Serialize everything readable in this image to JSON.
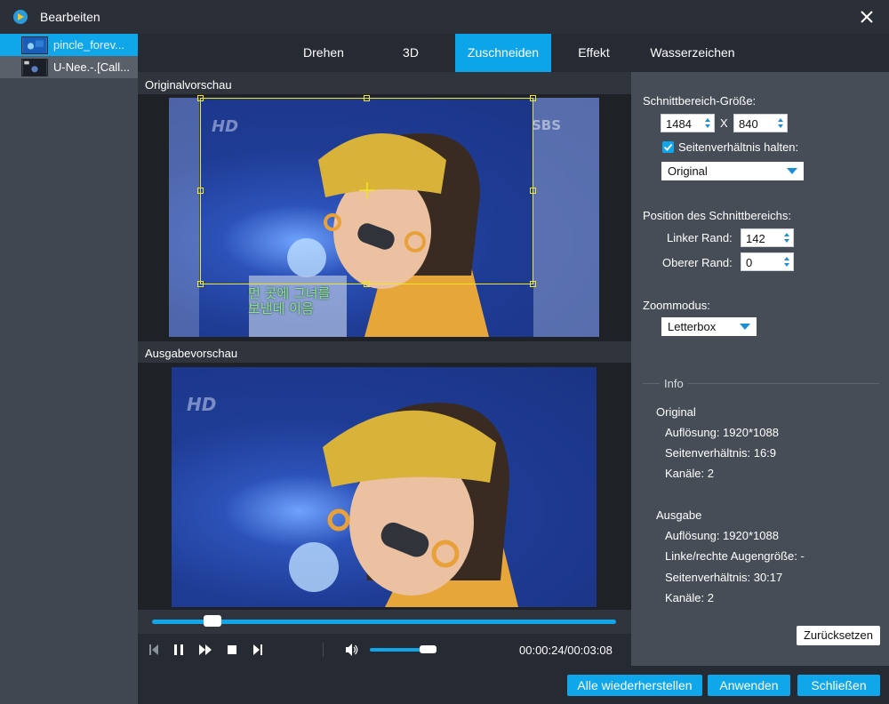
{
  "window": {
    "title": "Bearbeiten"
  },
  "files": [
    {
      "name": "pincle_forev...",
      "active": true
    },
    {
      "name": "U-Nee.-.[Call...",
      "active": false
    }
  ],
  "tabs": [
    "Drehen",
    "3D",
    "Zuschneiden",
    "Effekt",
    "Wasserzeichen"
  ],
  "active_tab": "Zuschneiden",
  "preview": {
    "original_label": "Originalvorschau",
    "output_label": "Ausgabevorschau",
    "hd_mark": "HD",
    "sbs_mark": "SBS",
    "subtitle_line1": "먼 곳에 그녀를",
    "subtitle_line2": "보낸데 이음"
  },
  "playback": {
    "time": "00:00:24/00:03:08",
    "progress": 0.13,
    "volume": 0.75
  },
  "crop": {
    "size_label": "Schnittbereich-Größe:",
    "width": "1484",
    "x_sep": "X",
    "height": "840",
    "keep_ratio_label": "Seitenverhältnis halten:",
    "keep_ratio_checked": true,
    "ratio_value": "Original",
    "position_label": "Position des Schnittbereichs:",
    "left_label": "Linker Rand:",
    "left_value": "142",
    "top_label": "Oberer Rand:",
    "top_value": "0",
    "zoom_label": "Zoommodus:",
    "zoom_value": "Letterbox"
  },
  "info": {
    "title": "Info",
    "original_title": "Original",
    "original_resolution": "Auflösung: 1920*1088",
    "original_ratio": "Seitenverhältnis: 16:9",
    "original_channels": "Kanäle: 2",
    "output_title": "Ausgabe",
    "output_resolution": "Auflösung: 1920*1088",
    "output_eye": "Linke/rechte Augengröße: -",
    "output_ratio": "Seitenverhältnis: 30:17",
    "output_channels": "Kanäle: 2"
  },
  "buttons": {
    "reset": "Zurücksetzen",
    "restore_all": "Alle wiederherstellen",
    "apply": "Anwenden",
    "close": "Schließen"
  },
  "colors": {
    "accent": "#10a6ea",
    "crop_frame": "#f2e61c",
    "panel": "#474d57",
    "background": "#262b33"
  },
  "icons": [
    "app-logo-icon",
    "close-icon",
    "skip-back-icon",
    "pause-icon",
    "fast-forward-icon",
    "stop-icon",
    "skip-end-icon",
    "volume-icon",
    "dropdown-caret-icon",
    "checkmark-icon"
  ]
}
